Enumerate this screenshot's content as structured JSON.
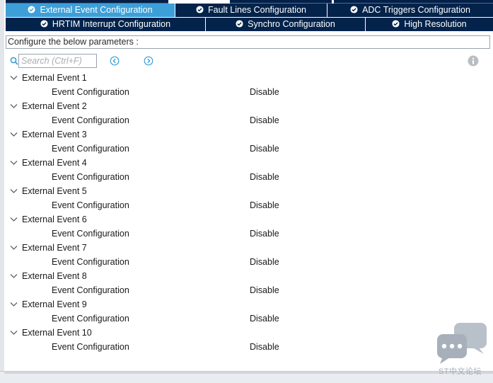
{
  "tabs": {
    "row1": [
      {
        "label": "External Event Configuration",
        "active": true
      },
      {
        "label": "Fault Lines Configuration",
        "active": false
      },
      {
        "label": "ADC Triggers Configuration",
        "active": false
      }
    ],
    "row2": [
      {
        "label": "HRTIM Interrupt Configuration",
        "active": false
      },
      {
        "label": "Synchro Configuration",
        "active": false
      },
      {
        "label": "High Resolution",
        "active": false
      }
    ]
  },
  "header": {
    "text": "Configure the below parameters :"
  },
  "search": {
    "placeholder": "Search (Ctrl+F)"
  },
  "groups": [
    {
      "title": "External Event 1",
      "param": "Event Configuration",
      "value": "Disable"
    },
    {
      "title": "External Event 2",
      "param": "Event Configuration",
      "value": "Disable"
    },
    {
      "title": "External Event 3",
      "param": "Event Configuration",
      "value": "Disable"
    },
    {
      "title": "External Event 4",
      "param": "Event Configuration",
      "value": "Disable"
    },
    {
      "title": "External Event 5",
      "param": "Event Configuration",
      "value": "Disable"
    },
    {
      "title": "External Event 6",
      "param": "Event Configuration",
      "value": "Disable"
    },
    {
      "title": "External Event 7",
      "param": "Event Configuration",
      "value": "Disable"
    },
    {
      "title": "External Event 8",
      "param": "Event Configuration",
      "value": "Disable"
    },
    {
      "title": "External Event 9",
      "param": "Event Configuration",
      "value": "Disable"
    },
    {
      "title": "External Event 10",
      "param": "Event Configuration",
      "value": "Disable"
    }
  ],
  "watermark": {
    "text": "ST中文论坛"
  },
  "colors": {
    "tab_bg": "#03234b",
    "tab_active_bg": "#3d9fd8",
    "tab_text": "#ffffff",
    "accent": "#3d9fd8"
  },
  "icons": {
    "tab": "check-circle-icon",
    "search": "search-icon",
    "prev": "chevron-left-circle-icon",
    "next": "chevron-right-circle-icon",
    "info": "info-icon",
    "expand": "chevron-down-icon"
  }
}
